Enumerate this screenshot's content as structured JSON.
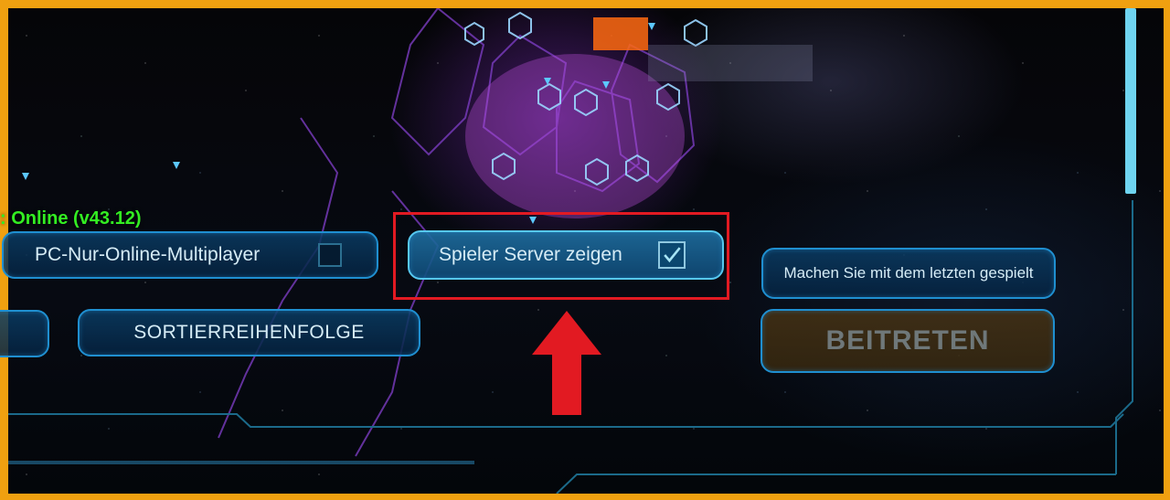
{
  "status": {
    "text": ": Online (v43.12)"
  },
  "filters": {
    "pc_online_label": "PC-Nur-Online-Multiplayer",
    "pc_online_checked": false,
    "show_player_servers_label": "Spieler Server zeigen",
    "show_player_servers_checked": true,
    "last_played_label": "Machen Sie mit dem letzten gespielt",
    "sort_order_label": "SORTIERREIHENFOLGE"
  },
  "actions": {
    "join_label": "BEITRETEN"
  },
  "colors": {
    "border": "#f0a010",
    "status": "#33ee22",
    "highlight": "#e21a22",
    "accent": "#1f8fd0"
  },
  "icons": {
    "checkbox": "checkbox-icon",
    "checkmark": "checkmark-icon",
    "annotation_arrow": "up-arrow-icon"
  }
}
